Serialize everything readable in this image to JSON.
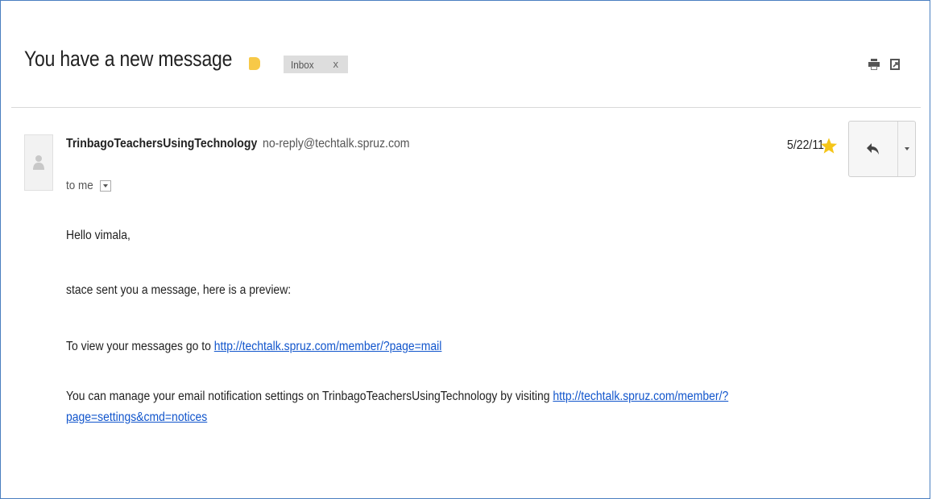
{
  "email": {
    "subject": "You have a new message",
    "label": {
      "name": "Inbox",
      "remove": "x",
      "color": "#f7c948"
    },
    "sender": {
      "name": "TrinbagoTeachersUsingTechnology",
      "address": "no-reply@techtalk.spruz.com"
    },
    "recipient": "to me",
    "date": "5/22/11",
    "starred": true,
    "body": {
      "greeting": "Hello vimala,",
      "preview": "stace sent you a message, here is a preview:",
      "view_prefix": "To view your messages go to ",
      "view_link": "http://techtalk.spruz.com/member/?page=mail",
      "manage_prefix": "You can manage your email notification settings on TrinbagoTeachersUsingTechnology by visiting ",
      "manage_link_part1": "http://techtalk.spruz.com/member/?",
      "manage_link_part2": "page=settings&cmd=notices"
    }
  },
  "icons": {
    "print": "print-icon",
    "popout": "new-window-icon",
    "star": "star-icon",
    "reply": "reply-icon",
    "more": "chevron-down-icon"
  },
  "colors": {
    "link": "#1155cc",
    "star": "#f5c518",
    "frame": "#4a7fc0"
  }
}
